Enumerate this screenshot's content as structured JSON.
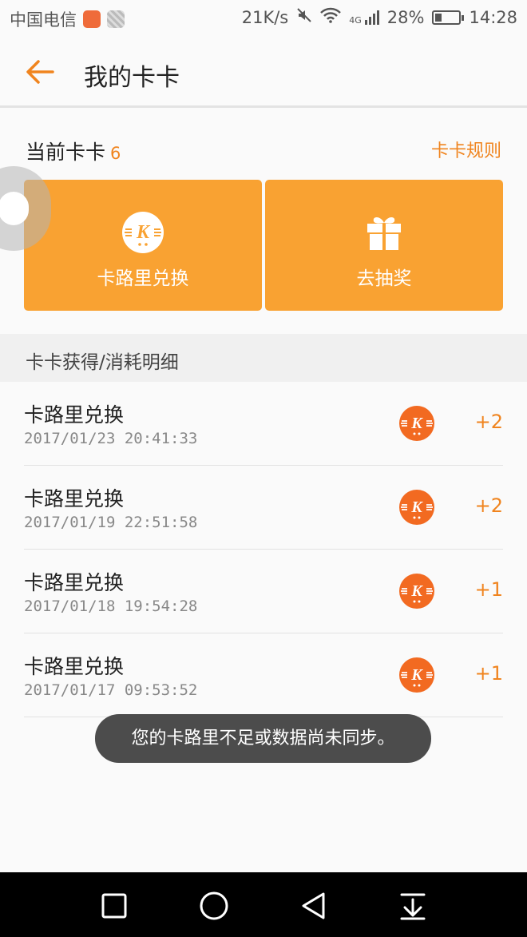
{
  "status_bar": {
    "carrier": "中国电信",
    "speed": "21K/s",
    "network": "4G",
    "battery": "28%",
    "battery_level": 0.28,
    "time": "14:28",
    "icons": [
      "notification-app-icon",
      "notification-app-icon-2",
      "mute-icon",
      "wifi-icon",
      "signal-icon",
      "battery-icon"
    ]
  },
  "app_bar": {
    "back_icon": "back-arrow-icon",
    "title": "我的卡卡"
  },
  "kaka": {
    "current_label": "当前卡卡",
    "current_count": "6",
    "rules_link": "卡卡规则",
    "tiles": [
      {
        "label": "卡路里兑换",
        "icon": "kaka-coin-icon"
      },
      {
        "label": "去抽奖",
        "icon": "gift-icon"
      }
    ]
  },
  "history": {
    "title": "卡卡获得/消耗明细",
    "rows": [
      {
        "name": "卡路里兑换",
        "time": "2017/01/23 20:41:33",
        "points": "+2"
      },
      {
        "name": "卡路里兑换",
        "time": "2017/01/19 22:51:58",
        "points": "+2"
      },
      {
        "name": "卡路里兑换",
        "time": "2017/01/18 19:54:28",
        "points": "+1"
      },
      {
        "name": "卡路里兑换",
        "time": "2017/01/17 09:53:52",
        "points": "+1"
      }
    ]
  },
  "toast": "您的卡路里不足或数据尚未同步。",
  "nav_bar": {
    "buttons": [
      "recent-apps-icon",
      "home-icon",
      "back-icon",
      "notification-pull-down-icon"
    ]
  },
  "colors": {
    "accent": "#f0841e",
    "tile": "#f9a232"
  }
}
